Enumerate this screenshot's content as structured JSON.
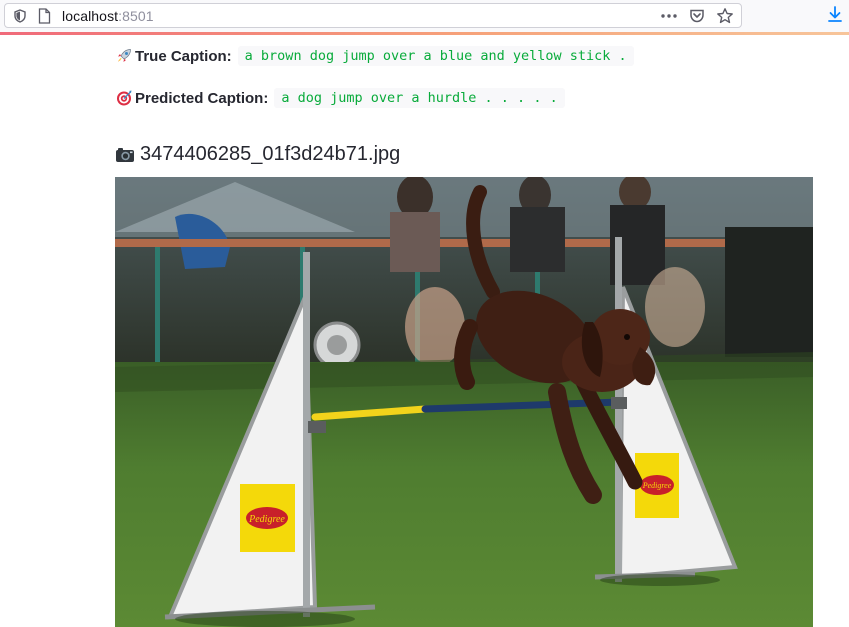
{
  "browser": {
    "url_host": "localhost",
    "url_port": ":8501",
    "icons": [
      "shield-icon",
      "page-icon",
      "more-icon",
      "pocket-icon",
      "bookmark-star-icon",
      "download-icon"
    ]
  },
  "true_caption": {
    "label": "True Caption:",
    "text": "a brown dog jump over a blue and yellow stick ."
  },
  "predicted_caption": {
    "label": "Predicted Caption:",
    "text": "a dog jump over a hurdle . . . . ."
  },
  "image": {
    "filename": "3474406285_01f3d24b71.jpg",
    "brand_text": "Pedigree"
  },
  "colors": {
    "code_text": "#09ab3b",
    "code_bg": "#f8f8fa",
    "download_blue": "#0a84ff"
  }
}
